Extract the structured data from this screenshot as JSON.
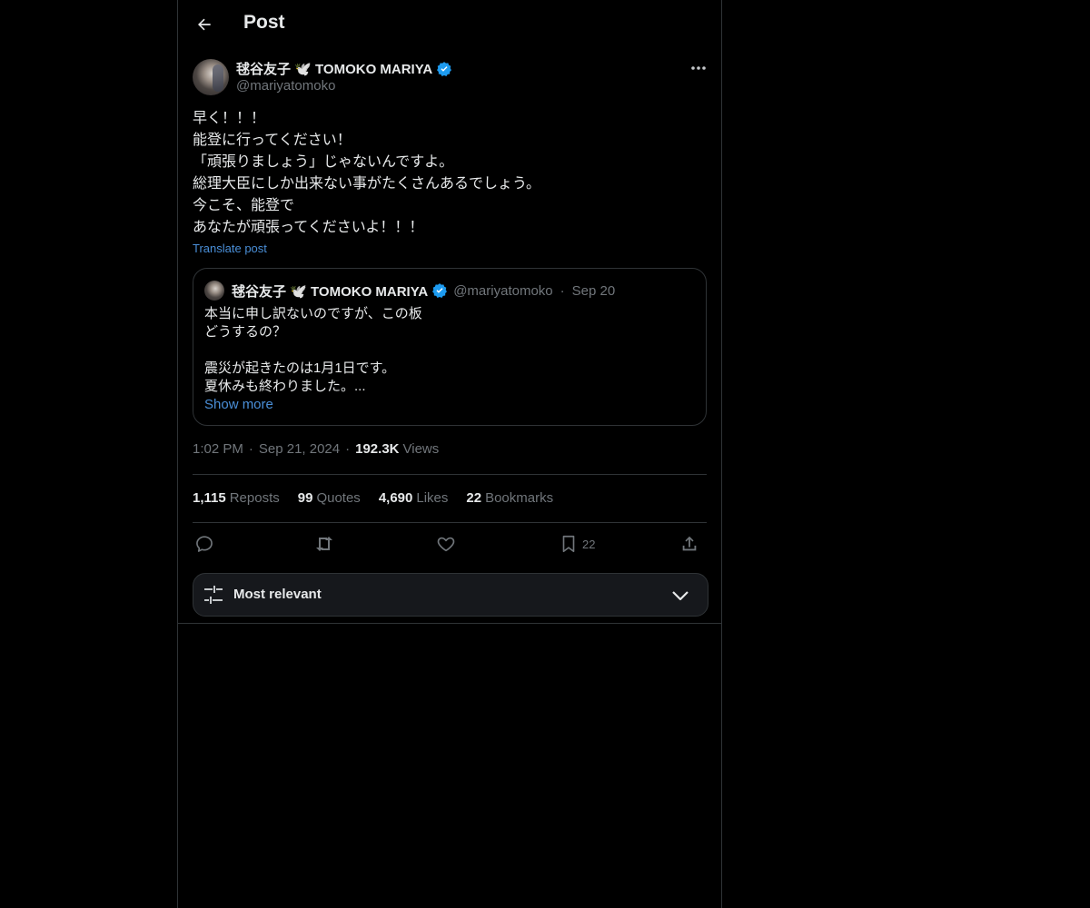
{
  "header": {
    "title": "Post",
    "back_icon": "arrow-left-icon"
  },
  "post": {
    "author": {
      "name": "毬谷友子 🕊️ TOMOKO MARIYA",
      "handle": "@mariyatomoko",
      "verified": true
    },
    "text": "早く！！！\n能登に行ってください！\n「頑張りましょう」じゃないんですよ。\n総理大臣にしか出来ない事がたくさんあるでしょう。\n今こそ、能登で\nあなたが頑張ってくださいよ！！！",
    "translate_label": "Translate post",
    "quote": {
      "author_name": "毬谷友子 🕊️ TOMOKO MARIYA",
      "handle": "@mariyatomoko",
      "dot": "·",
      "date": "Sep 20",
      "text": "本当に申し訳ないのですが、この板\nどうするの？\n\n震災が起きたのは1月1日です。\n夏休みも終わりました。...",
      "show_more": "Show more"
    },
    "meta": {
      "time": "1:02 PM",
      "sep": "·",
      "date": "Sep 21, 2024",
      "views_count": "192.3K",
      "views_label": "Views"
    },
    "stats": {
      "reposts_count": "1,115",
      "reposts_label": "Reposts",
      "quotes_count": "99",
      "quotes_label": "Quotes",
      "likes_count": "4,690",
      "likes_label": "Likes",
      "bookmarks_count": "22",
      "bookmarks_label": "Bookmarks"
    },
    "actions": {
      "bookmark_count": "22"
    }
  },
  "sort": {
    "label": "Most relevant"
  },
  "colors": {
    "background": "#000000",
    "text": "#e7e9ea",
    "muted": "#71767b",
    "link": "#4a8fd8",
    "verified": "#1d9bf0",
    "border": "#2f3336"
  }
}
